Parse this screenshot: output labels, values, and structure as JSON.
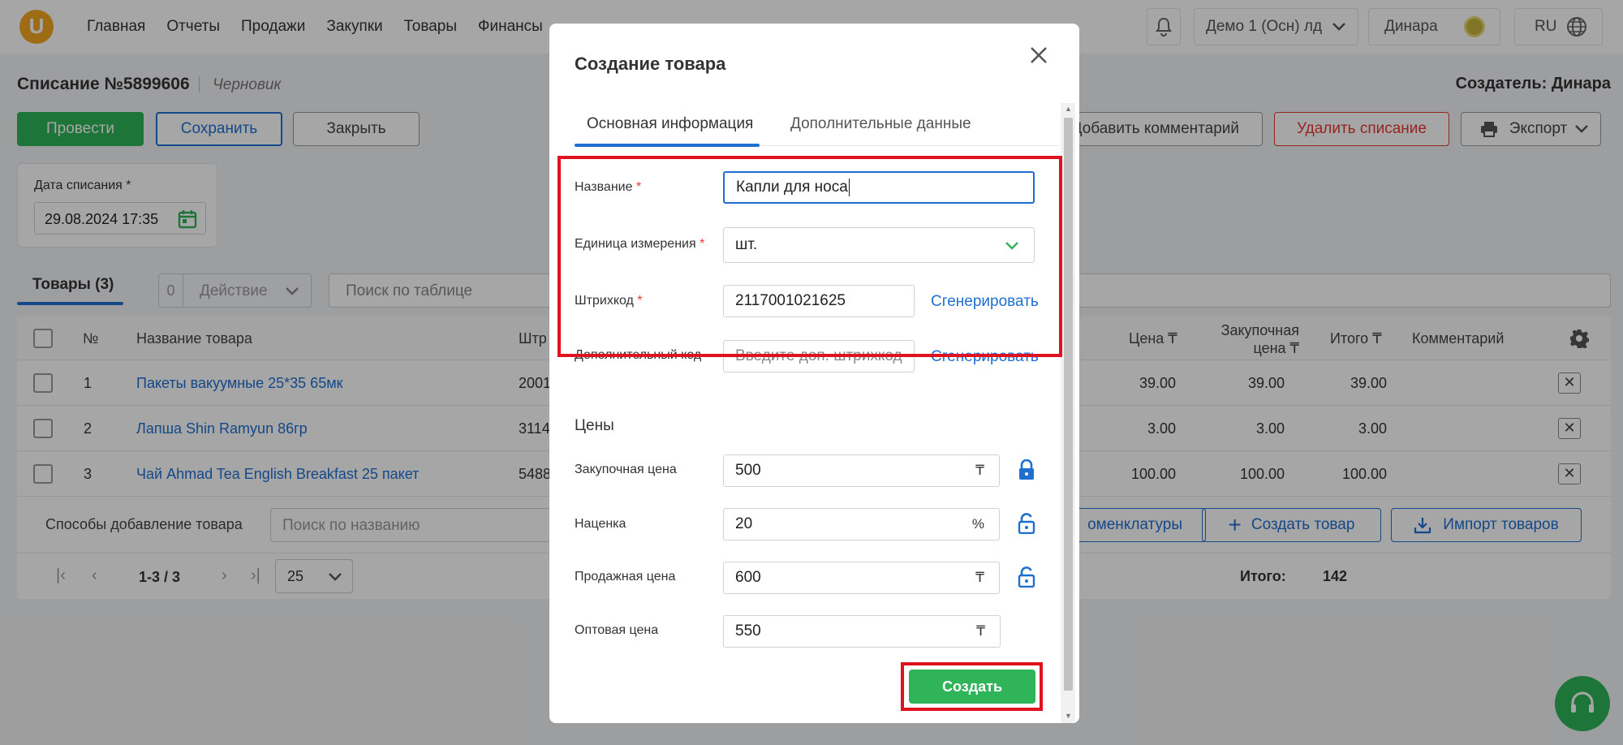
{
  "header": {
    "logo": "U",
    "nav": [
      "Главная",
      "Отчеты",
      "Продажи",
      "Закупки",
      "Товары",
      "Финансы"
    ],
    "account": "Демо 1 (Осн) лд",
    "user": "Динара",
    "lang": "RU"
  },
  "page": {
    "title": "Списание №5899606",
    "status": "Черновик",
    "creator": "Создатель: Динара",
    "buttons": {
      "conduct": "Провести",
      "save": "Сохранить",
      "close": "Закрыть",
      "add_comment": "Добавить комментарий",
      "delete": "Удалить списание",
      "export": "Экспорт"
    },
    "date_label": "Дата списания *",
    "date_value": "29.08.2024 17:35"
  },
  "tabs": {
    "products": "Товары",
    "products_count": "(3)"
  },
  "toolbar": {
    "selected": "0",
    "action": "Действие",
    "search_placeholder": "Поиск по таблице"
  },
  "table": {
    "headers": {
      "num": "№",
      "name": "Название товара",
      "barcode": "Штр",
      "price": "Цена ₸",
      "purchase1": "Закупочная",
      "purchase2": "цена ₸",
      "total": "Итого ₸",
      "comment": "Комментарий"
    },
    "rows": [
      {
        "num": "1",
        "name": "Пакеты вакуумные 25*35 65мк",
        "barcode": "2001",
        "price": "39.00",
        "purchase": "39.00",
        "total": "39.00"
      },
      {
        "num": "2",
        "name": "Лапша Shin Ramyun 86гр",
        "barcode": "3114",
        "price": "3.00",
        "purchase": "3.00",
        "total": "3.00"
      },
      {
        "num": "3",
        "name": "Чай Ahmad Tea English Breakfast 25 пакет",
        "barcode": "5488",
        "price": "100.00",
        "purchase": "100.00",
        "total": "100.00"
      }
    ]
  },
  "add_methods": {
    "label": "Способы добавление товара",
    "search_placeholder": "Поиск по названию",
    "nomenclature": "оменклатуры",
    "create": "Создать товар",
    "import": "Импорт товаров"
  },
  "pagination": {
    "range": "1-3 / 3",
    "per_page": "25",
    "total_label": "Итого:",
    "total_value": "142"
  },
  "modal": {
    "title": "Создание товара",
    "tab_main": "Основная информация",
    "tab_extra": "Дополнительные данные",
    "name_label": "Название",
    "name_value": "Капли для носа",
    "unit_label": "Единица измерения",
    "unit_value": "шт.",
    "barcode_label": "Штрихкод",
    "barcode_value": "2117001021625",
    "generate": "Сгенерировать",
    "extra_code_label": "Дополнительный код",
    "extra_code_placeholder": "Введите доп. штрихкод",
    "prices_title": "Цены",
    "purchase_label": "Закупочная цена",
    "purchase_value": "500",
    "markup_label": "Наценка",
    "markup_value": "20",
    "sale_label": "Продажная цена",
    "sale_value": "600",
    "wholesale_label": "Оптовая цена",
    "wholesale_value": "550",
    "currency": "₸",
    "percent": "%",
    "create_button": "Создать"
  },
  "colors": {
    "green": "#2fb45a",
    "blue": "#1f6fd1",
    "red": "#e0121f",
    "orange": "#f5a623"
  }
}
